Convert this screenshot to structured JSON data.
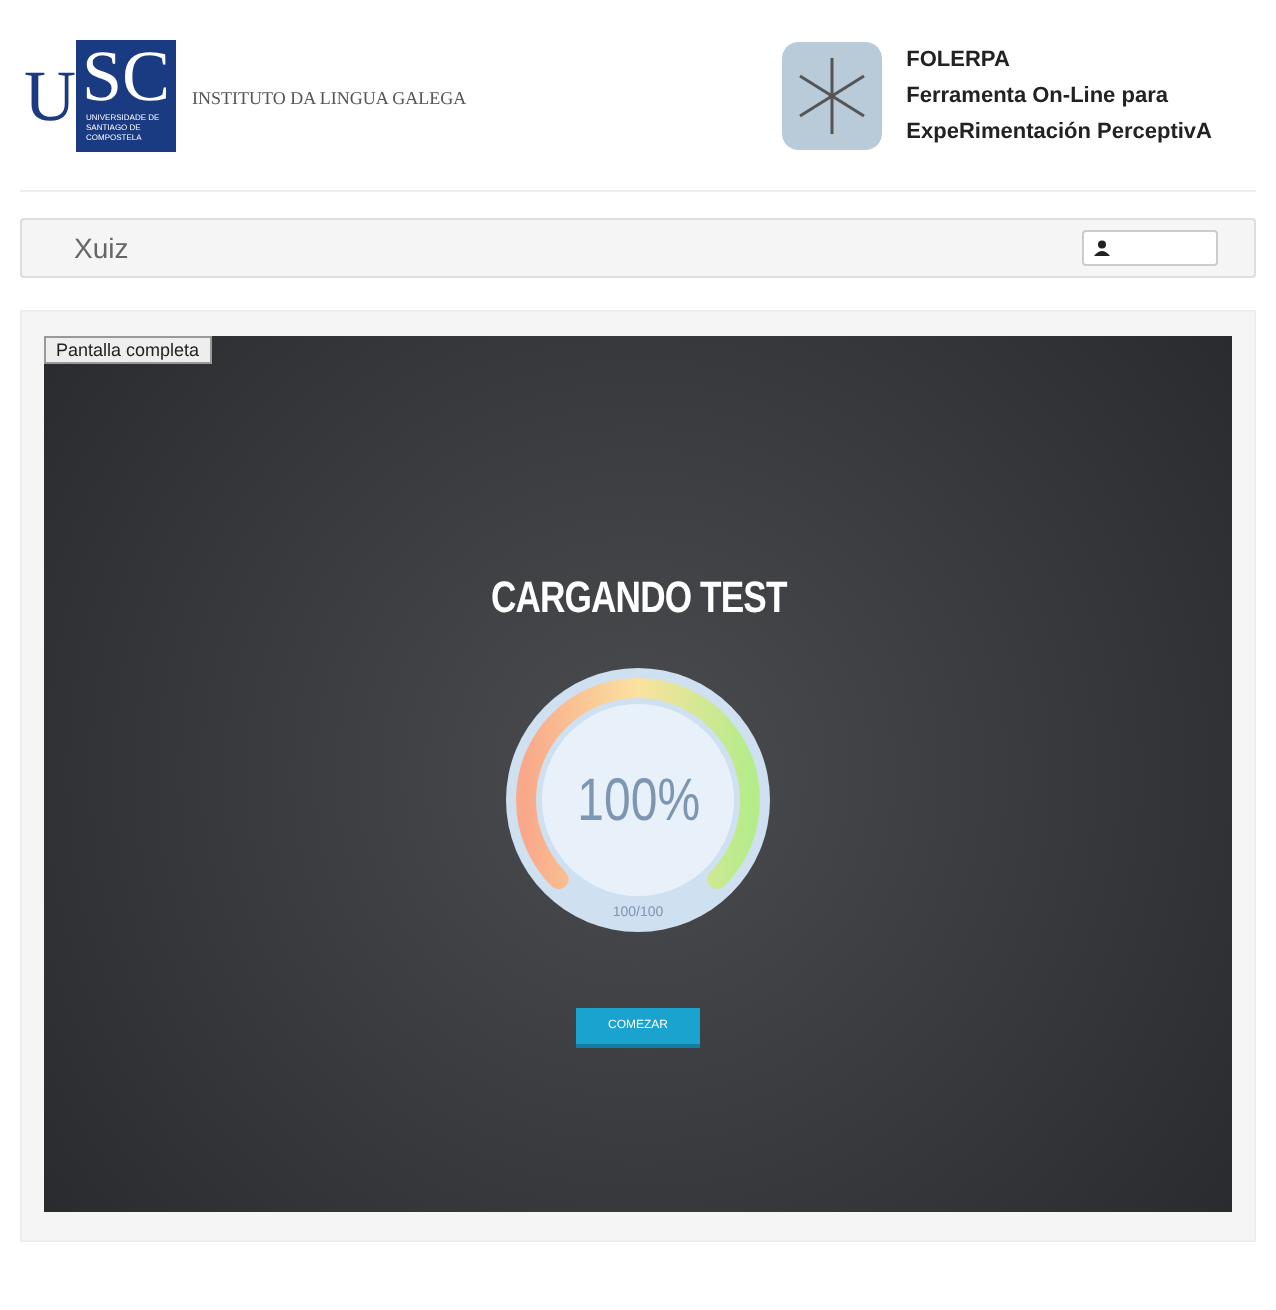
{
  "header": {
    "logo": {
      "letters": "USC",
      "small_text": "UNIVERSIDADE DE SANTIAGO DE COMPOSTELA"
    },
    "institute": "INSTITUTO DA LINGUA GALEGA",
    "app": {
      "name": "FOLERPA",
      "subtitle_lines": [
        "Ferramenta On-Line para",
        "ExpeRimentación PerceptivA"
      ]
    }
  },
  "navbar": {
    "brand": "Xuiz"
  },
  "stage": {
    "fullscreen_button": "Pantalla completa",
    "title": "CARGANDO TEST",
    "gauge": {
      "reading": "100%",
      "sub_reading": "100/100"
    },
    "start_button": "COMEZAR"
  }
}
